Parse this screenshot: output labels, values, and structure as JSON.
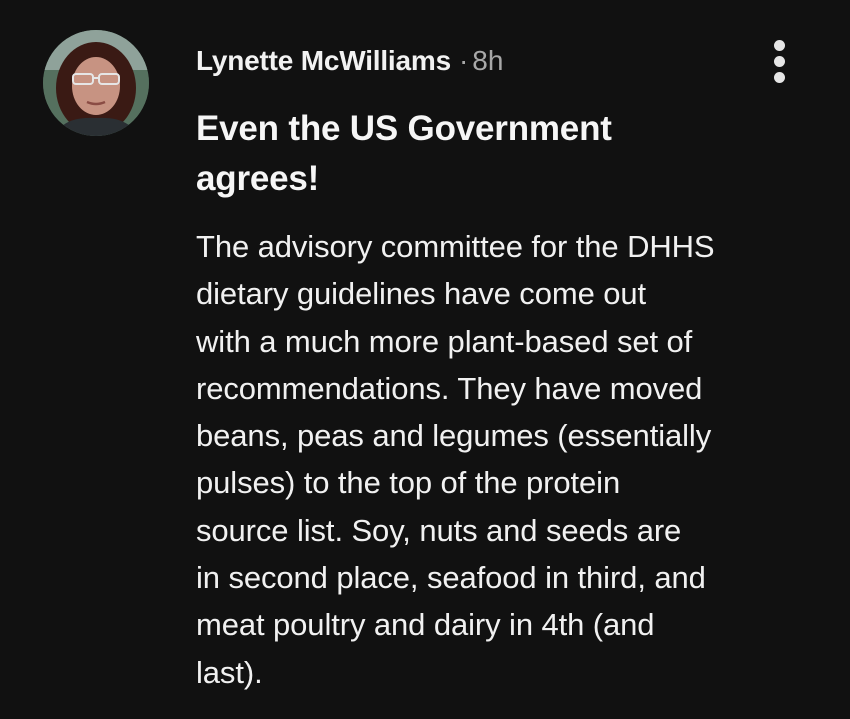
{
  "post": {
    "author": "Lynette McWilliams",
    "separator": "·",
    "time": "8h",
    "title": "Even the US Government\nagrees!",
    "body": "The advisory committee for the DHHS\ndietary guidelines have come out\nwith a much more plant-based set of\nrecommendations.  They have moved\nbeans, peas and legumes (essentially\npulses) to the top of the protein\nsource list. Soy, nuts and seeds are\nin second place, seafood in third, and\nmeat poultry and dairy in 4th (and\nlast)."
  },
  "icons": {
    "menu": "more-vertical-icon",
    "avatar": "profile-photo"
  },
  "colors": {
    "background": "#111111",
    "text": "#f4f4f4",
    "muted": "#a8a8a8"
  }
}
